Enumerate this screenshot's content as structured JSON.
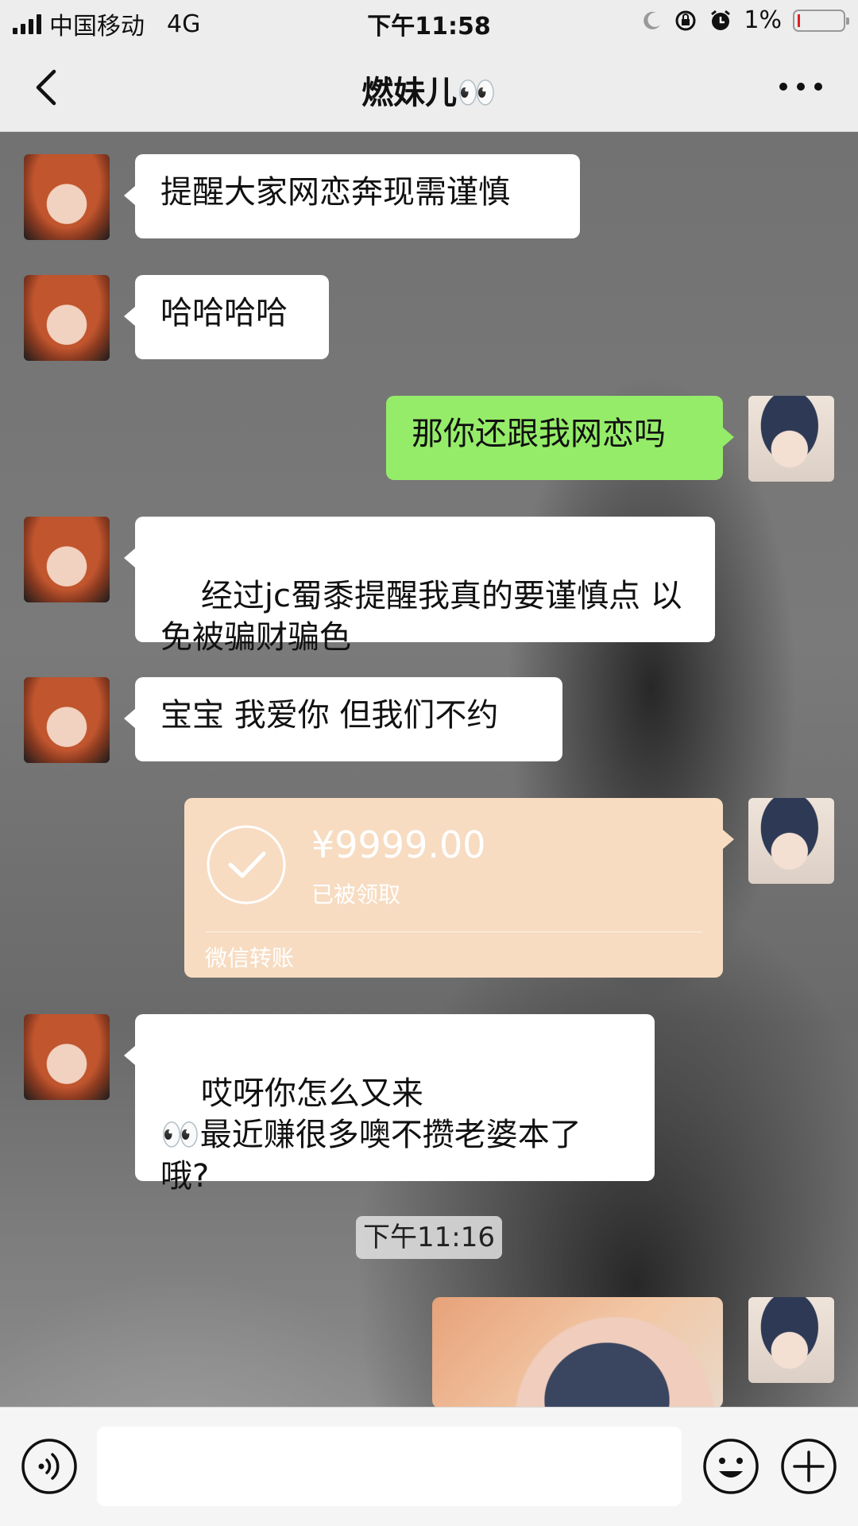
{
  "status_bar": {
    "carrier": "中国移动",
    "network": "4G",
    "time": "下午11:58",
    "battery": "1%"
  },
  "nav": {
    "title": "燃妹儿👀"
  },
  "messages": [
    {
      "side": "in",
      "text": "提醒大家网恋奔现需谨慎"
    },
    {
      "side": "in",
      "text": "哈哈哈哈"
    },
    {
      "side": "out",
      "text": "那你还跟我网恋吗"
    },
    {
      "side": "in",
      "text": "经过jc蜀黍提醒我真的要谨慎点 以免被骗财骗色"
    },
    {
      "side": "in",
      "text": "宝宝 我爱你 但我们不约"
    },
    {
      "side": "in",
      "text": "哎呀你怎么又来\n👀最近赚很多噢不攒老婆本了哦?"
    }
  ],
  "transfer": {
    "amount": "¥9999.00",
    "status": "已被领取",
    "footer": "微信转账"
  },
  "time_divider": "下午11:16",
  "colors": {
    "outgoing_bubble": "#95ec69",
    "incoming_bubble": "#ffffff",
    "transfer_card": "#f7dcc2"
  },
  "icons": {
    "back": "chevron-left-icon",
    "more": "more-dots-icon",
    "voice": "voice-icon",
    "emoji": "emoji-icon",
    "plus": "plus-icon"
  }
}
